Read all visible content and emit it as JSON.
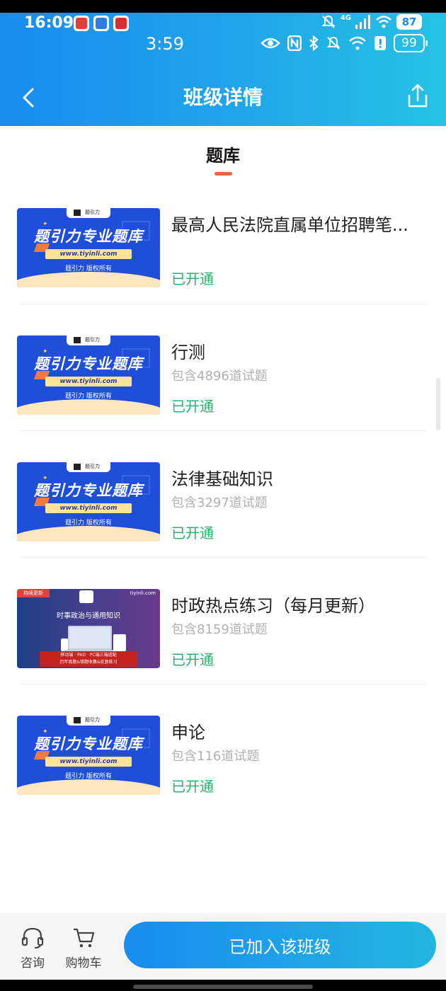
{
  "status_bar": {
    "time": "16:09",
    "network": "4G",
    "battery": "87"
  },
  "app_status_bar": {
    "time": "3:59",
    "battery": "99"
  },
  "nav": {
    "title": "班级详情"
  },
  "tab": {
    "label": "题库"
  },
  "thumb_text": {
    "headline": "题引力专业题库",
    "url": "www.tiyinli.com",
    "copyright": "题引力 版权所有",
    "logo": "题引力",
    "current_tag": "持续更新",
    "current_site": "tiyinli.com",
    "current_title": "时事政治与通用知识",
    "current_box_line1": "移动端 · PAD · PC端三端适配",
    "current_box_line2": "历年真题&错题收集&反复练习"
  },
  "items": [
    {
      "title": "最高人民法院直属单位招聘笔...",
      "subtitle": "",
      "status": "已开通",
      "thumb": "blue"
    },
    {
      "title": "行测",
      "subtitle": "包含4896道试题",
      "status": "已开通",
      "thumb": "blue"
    },
    {
      "title": "法律基础知识",
      "subtitle": "包含3297道试题",
      "status": "已开通",
      "thumb": "blue"
    },
    {
      "title": "时政热点练习（每月更新）",
      "subtitle": "包含8159道试题",
      "status": "已开通",
      "thumb": "purple"
    },
    {
      "title": "申论",
      "subtitle": "包含116道试题",
      "status": "已开通",
      "thumb": "blue"
    }
  ],
  "bottom": {
    "consult_label": "咨询",
    "cart_label": "购物车",
    "joined_label": "已加入该班级"
  },
  "colors": {
    "header_gradient_start": "#1a8cf0",
    "header_gradient_end": "#27c2e3",
    "status_open": "#27b26b",
    "tab_underline": "#f0643c",
    "subtitle": "#b0b0b0"
  }
}
